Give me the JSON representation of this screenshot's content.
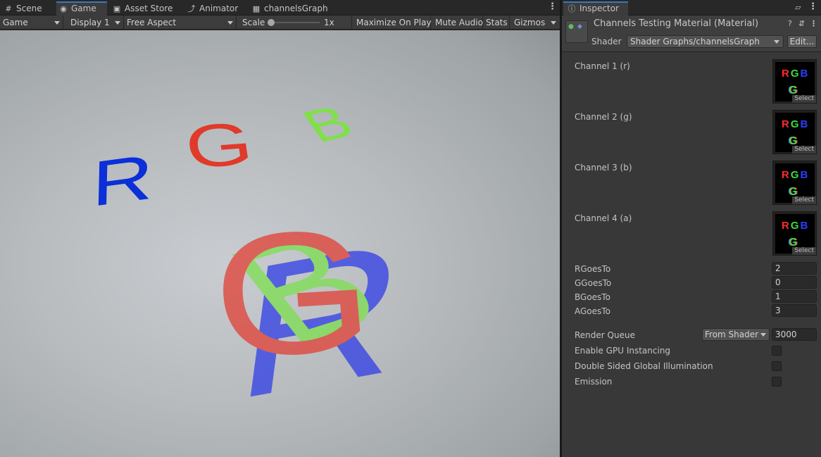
{
  "left_tabs": [
    {
      "label": "Scene",
      "icon": "scene-grid-icon"
    },
    {
      "label": "Game",
      "icon": "gamepad-icon"
    },
    {
      "label": "Asset Store",
      "icon": "store-bag-icon"
    },
    {
      "label": "Animator",
      "icon": "animator-icon"
    },
    {
      "label": "channelsGraph",
      "icon": "graph-icon"
    }
  ],
  "game_toolbar": {
    "display_mode": "Game",
    "display": "Display 1",
    "aspect": "Free Aspect",
    "scale_label": "Scale",
    "scale_value": "1x",
    "scale_fraction": 0,
    "maximize": "Maximize On Play",
    "mute": "Mute Audio",
    "stats": "Stats",
    "gizmos": "Gizmos"
  },
  "scene_letters": {
    "top": [
      {
        "char": "R",
        "color": "#0b2fd8"
      },
      {
        "char": "G",
        "color": "#e03a2a"
      },
      {
        "char": "B",
        "color": "#7fe04a"
      }
    ],
    "overlay": [
      {
        "char": "R",
        "color": "#2b39e8"
      },
      {
        "char": "B",
        "color": "#79e14a"
      },
      {
        "char": "G",
        "color": "#e23b2f"
      }
    ]
  },
  "inspector": {
    "tab_label": "Inspector",
    "tab_icon": "info-icon",
    "title": "Channels Testing Material (Material)",
    "shader_label": "Shader",
    "shader_value": "Shader Graphs/channelsGraph",
    "edit_label": "Edit...",
    "channels": [
      {
        "label": "Channel 1 (r)",
        "select_label": "Select",
        "tex_r": "R",
        "tex_g": "G",
        "tex_b": "B",
        "tex_mini": "G"
      },
      {
        "label": "Channel 2 (g)",
        "select_label": "Select",
        "tex_r": "R",
        "tex_g": "G",
        "tex_b": "B",
        "tex_mini": "G"
      },
      {
        "label": "Channel 3 (b)",
        "select_label": "Select",
        "tex_r": "R",
        "tex_g": "G",
        "tex_b": "B",
        "tex_mini": "G"
      },
      {
        "label": "Channel 4 (a)",
        "select_label": "Select",
        "tex_r": "R",
        "tex_g": "G",
        "tex_b": "B",
        "tex_mini": "G"
      }
    ],
    "goes_to": [
      {
        "label": "RGoesTo",
        "value": "2"
      },
      {
        "label": "GGoesTo",
        "value": "0"
      },
      {
        "label": "BGoesTo",
        "value": "1"
      },
      {
        "label": "AGoesTo",
        "value": "3"
      }
    ],
    "render_queue": {
      "label": "Render Queue",
      "mode": "From Shader",
      "value": "3000"
    },
    "toggles": [
      {
        "label": "Enable GPU Instancing",
        "checked": false
      },
      {
        "label": "Double Sided Global Illumination",
        "checked": false
      },
      {
        "label": "Emission",
        "checked": false
      }
    ]
  }
}
